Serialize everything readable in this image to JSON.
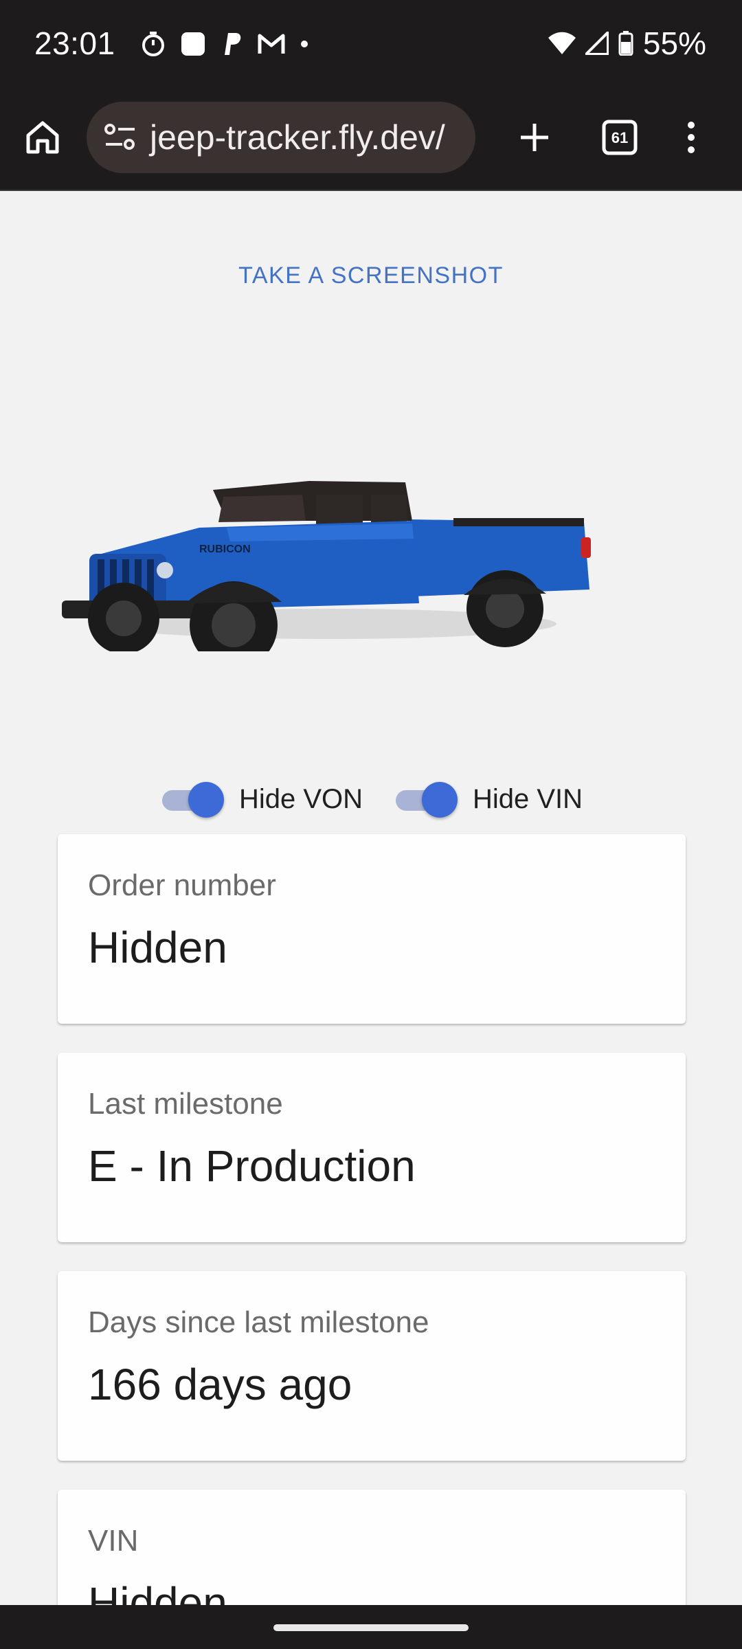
{
  "status_bar": {
    "time": "23:01",
    "battery": "55%",
    "left_icons": [
      "timer-icon",
      "square-icon",
      "paypal-icon",
      "gmail-icon",
      "dot-icon"
    ],
    "right_icons": [
      "wifi-icon",
      "signal-icon",
      "battery-icon"
    ]
  },
  "browser": {
    "url": "jeep-tracker.fly.dev/",
    "tab_count": "61"
  },
  "page": {
    "screenshot_button": "TAKE A SCREENSHOT",
    "toggles": [
      {
        "label": "Hide VON",
        "on": true
      },
      {
        "label": "Hide VIN",
        "on": true
      }
    ],
    "cards": [
      {
        "label": "Order number",
        "value": "Hidden"
      },
      {
        "label": "Last milestone",
        "value": "E - In Production"
      },
      {
        "label": "Days since last milestone",
        "value": "166 days ago"
      },
      {
        "label": "VIN",
        "value": "Hidden"
      }
    ],
    "truck_badge": "RUBICON"
  },
  "colors": {
    "accent": "#4472c4",
    "toggle_on": "#3d6ad6",
    "truck_blue": "#1f5fc4"
  }
}
